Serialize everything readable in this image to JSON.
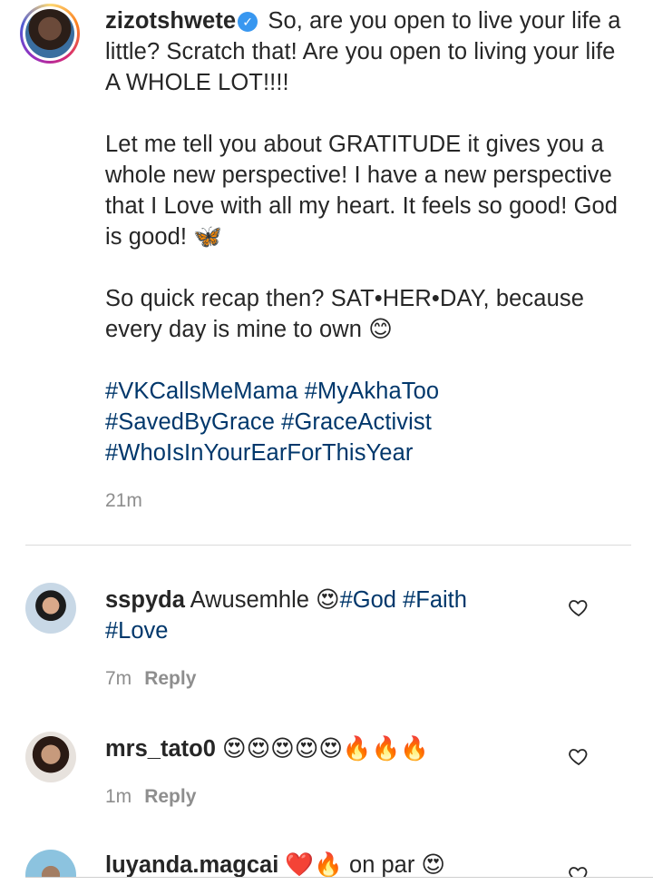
{
  "post": {
    "username": "zizotshwete",
    "verified_icon": "verified-badge-icon",
    "text_1": "So, are you open to live your life a little? Scratch that! Are you open to living your life A WHOLE LOT!!!!",
    "text_2": "Let me tell you about GRATITUDE it gives you a whole new perspective! I have a new perspective that I Love with all my heart. It feels so good! God is good! 🦋",
    "text_3": "So quick recap then? SAT•HER•DAY, because every day is mine to own 😊",
    "hashtags": [
      "#VKCallsMeMama",
      "#MyAkhaToo",
      "#SavedByGrace",
      "#GraceActivist",
      "#WhoIsInYourEarForThisYear"
    ],
    "time": "21m"
  },
  "comments": [
    {
      "username": "sspyda",
      "text": "Awusemhle 😍",
      "hashtags": [
        "#God",
        "#Faith",
        "#Love"
      ],
      "time": "7m",
      "reply_label": "Reply"
    },
    {
      "username": "mrs_tato0",
      "text": "😍😍😍😍😍🔥🔥🔥",
      "time": "1m",
      "reply_label": "Reply"
    },
    {
      "username": "luyanda.magcai",
      "text": "❤️🔥 on par 😍"
    }
  ],
  "colors": {
    "hashtag": "#00376b",
    "meta": "#8e8e8e",
    "verified": "#3897f0"
  }
}
